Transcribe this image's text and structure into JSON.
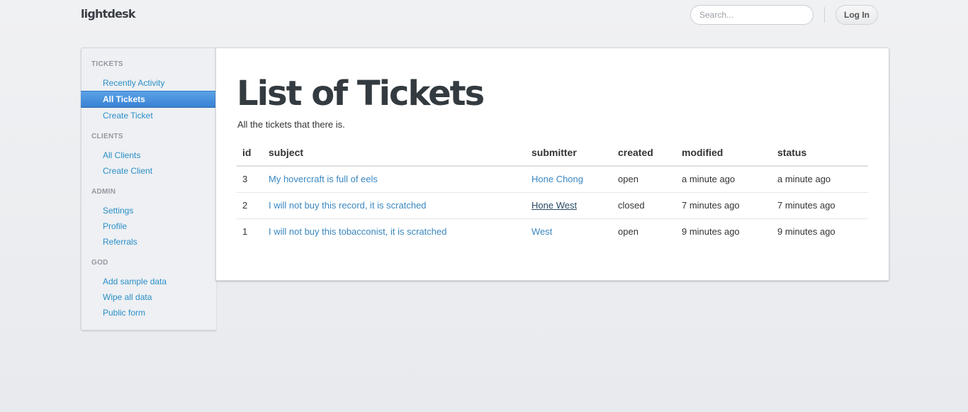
{
  "header": {
    "brand": "lightdesk",
    "search_placeholder": "Search...",
    "login_label": "Log In"
  },
  "sidebar": {
    "sections": [
      {
        "title": "TICKETS",
        "items": [
          "Recently Activity",
          "All Tickets",
          "Create Ticket"
        ]
      },
      {
        "title": "CLIENTS",
        "items": [
          "All Clients",
          "Create Client"
        ]
      },
      {
        "title": "ADMIN",
        "items": [
          "Settings",
          "Profile",
          "Referrals"
        ]
      },
      {
        "title": "GOD",
        "items": [
          "Add sample data",
          "Wipe all data",
          "Public form"
        ]
      }
    ],
    "active_item": "All Tickets"
  },
  "main": {
    "title": "List of Tickets",
    "description": "All the tickets that there is.",
    "table": {
      "columns": [
        "id",
        "subject",
        "submitter",
        "created",
        "modified",
        "status"
      ],
      "rows": [
        {
          "id": "3",
          "subject": "My hovercraft is full of eels",
          "submitter": "Hone Chong",
          "created": "open",
          "modified": "a minute ago",
          "status": "a minute ago"
        },
        {
          "id": "2",
          "subject": "I will not buy this record, it is scratched",
          "submitter": "Hone West",
          "created": "closed",
          "modified": "7 minutes ago",
          "status": "7 minutes ago"
        },
        {
          "id": "1",
          "subject": "I will not buy this tobacconist, it is scratched",
          "submitter": "West",
          "created": "open",
          "modified": "9 minutes ago",
          "status": "9 minutes ago"
        }
      ]
    }
  },
  "colors": {
    "link": "#3a87c0",
    "nav_link": "#2b8fc8",
    "active_nav": "#3a82d4"
  }
}
